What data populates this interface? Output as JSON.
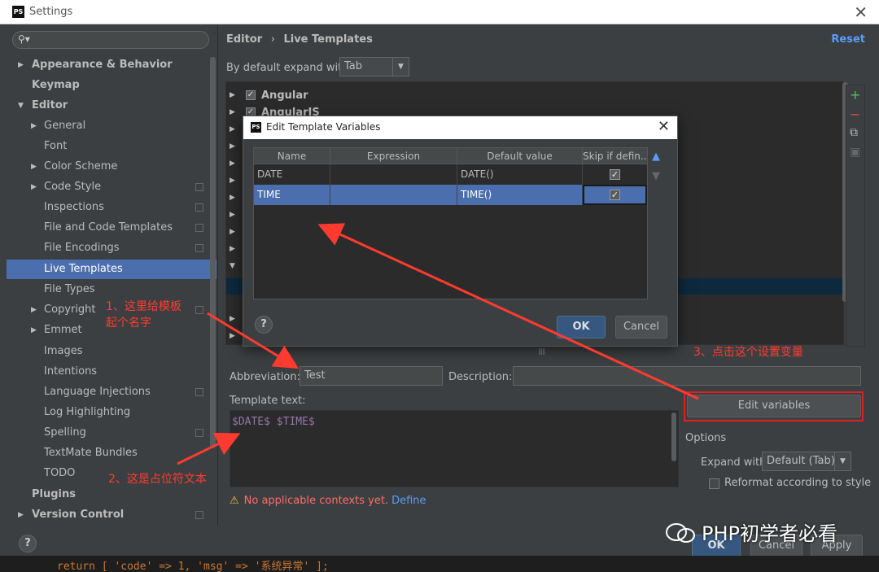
{
  "window": {
    "title": "Settings",
    "app_icon": "PS"
  },
  "search": {
    "placeholder": ""
  },
  "sidebar": {
    "items": [
      {
        "label": "Appearance & Behavior",
        "bold": true,
        "arrow": "right"
      },
      {
        "label": "Keymap",
        "bold": true
      },
      {
        "label": "Editor",
        "bold": true,
        "arrow": "down"
      },
      {
        "label": "General",
        "arrow": "right"
      },
      {
        "label": "Font"
      },
      {
        "label": "Color Scheme",
        "arrow": "right"
      },
      {
        "label": "Code Style",
        "arrow": "right"
      },
      {
        "label": "Inspections"
      },
      {
        "label": "File and Code Templates"
      },
      {
        "label": "File Encodings"
      },
      {
        "label": "Live Templates",
        "selected": true
      },
      {
        "label": "File Types"
      },
      {
        "label": "Copyright",
        "arrow": "right"
      },
      {
        "label": "Emmet",
        "arrow": "right"
      },
      {
        "label": "Images"
      },
      {
        "label": "Intentions"
      },
      {
        "label": "Language Injections"
      },
      {
        "label": "Log Highlighting"
      },
      {
        "label": "Spelling"
      },
      {
        "label": "TextMate Bundles"
      },
      {
        "label": "TODO"
      },
      {
        "label": "Plugins",
        "bold": true
      },
      {
        "label": "Version Control",
        "bold": true,
        "arrow": "right"
      }
    ]
  },
  "header": {
    "breadcrumb_parent": "Editor",
    "breadcrumb_sep": "›",
    "breadcrumb_current": "Live Templates",
    "reset": "Reset"
  },
  "expand": {
    "label": "By default expand with",
    "value": "Tab"
  },
  "templates": [
    {
      "name": "Angular",
      "checked": true
    },
    {
      "name": "AngularJS",
      "checked": true
    }
  ],
  "fields": {
    "abbreviation_label": "Abbreviation:",
    "abbreviation_value": "Test",
    "description_label": "Description:",
    "description_value": "",
    "template_text_label": "Template text:",
    "template_text": "$DATE$ $TIME$"
  },
  "warning": {
    "message": "No applicable contexts yet.",
    "link": "Define"
  },
  "edit_variables": "Edit variables",
  "options": {
    "title": "Options",
    "expand_label": "Expand with",
    "expand_value": "Default (Tab)",
    "reformat_label": "Reformat according to style"
  },
  "buttons": {
    "ok": "OK",
    "cancel": "Cancel",
    "apply": "Apply"
  },
  "dialog": {
    "title": "Edit Template Variables",
    "columns": [
      "Name",
      "Expression",
      "Default value",
      "Skip if defin..."
    ],
    "rows": [
      {
        "name": "DATE",
        "expression": "",
        "default": "DATE()",
        "skip": true
      },
      {
        "name": "TIME",
        "expression": "",
        "default": "TIME()",
        "skip": true,
        "selected": true
      }
    ],
    "ok": "OK",
    "cancel": "Cancel"
  },
  "annotations": {
    "a1_line1": "1、这里给模板",
    "a1_line2": "起个名字",
    "a2": "2、这是占位符文本",
    "a3": "3、点击这个设置变量"
  },
  "watermark": "PHP初学者必看",
  "code_line": "return [ 'code' => 1, 'msg' => '系统异常' ];",
  "colors": {
    "accent": "#4b6eaf",
    "link": "#589df6",
    "annotation": "#ff3b30",
    "warning": "#ff6b6b"
  }
}
